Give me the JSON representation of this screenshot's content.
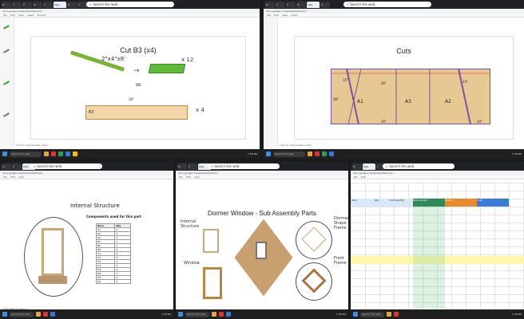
{
  "search_placeholder": "Search the web",
  "taskbar_search": "Search the web",
  "tab_label": "Pipe",
  "url": "docs.google.com/presentation/d/...",
  "menu": [
    "File",
    "Edit",
    "View",
    "Insert",
    "Format",
    "Slide",
    "Arrange",
    "Tools",
    "Help"
  ],
  "pane1": {
    "title": "Cut B3 (x4)",
    "dim_label": "2\"x4\"x8'",
    "times12": "x 12",
    "equals": "=",
    "times4": "x 4",
    "board_label": "B3",
    "dim_top": "38\"",
    "speaker": "Click to add speaker notes"
  },
  "pane2": {
    "title": "Cuts",
    "part_labels": [
      "A1",
      "A3",
      "A2"
    ],
    "dims": [
      "15\"",
      "26\"",
      "38\"",
      "24\"",
      "16\"",
      "34\""
    ],
    "speaker": "Click to add speaker notes"
  },
  "pane3": {
    "title": "Internal Structure",
    "subtitle": "Components used for this part",
    "table_header": [
      "Item",
      "Qty"
    ],
    "table_rows": [
      [
        "A1",
        "2"
      ],
      [
        "A2",
        "2"
      ],
      [
        "A3",
        "1"
      ],
      [
        "B1",
        "1"
      ],
      [
        "B2",
        "1"
      ],
      [
        "B3",
        "4"
      ],
      [
        "C1",
        "2"
      ],
      [
        "C2",
        "2"
      ],
      [
        "C3",
        "1"
      ],
      [
        "C4",
        "2"
      ],
      [
        "D1",
        "1"
      ],
      [
        "D2",
        "1"
      ],
      [
        "D3",
        "2"
      ],
      [
        "D4",
        "2"
      ]
    ],
    "speaker": "Type here to search"
  },
  "pane4": {
    "title": "Dormer Window - Sub Assembly Parts",
    "labels": [
      "Internal Structure",
      "Window",
      "Dormer Shape Frame",
      "Front Frame"
    ]
  },
  "pane5": {
    "header": [
      "Item",
      "Qty",
      "Cut Quantity",
      "Total Length",
      "Board",
      "Cost"
    ]
  },
  "clock": "7:58 PM"
}
